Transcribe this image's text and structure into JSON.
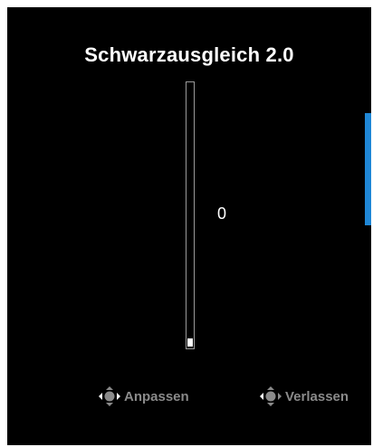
{
  "osd": {
    "title": "Schwarzausgleich 2.0",
    "value": "0",
    "slider": {
      "min": 0,
      "max": 20,
      "value": 0,
      "fill_fraction": 0.03
    },
    "colors": {
      "background": "#000000",
      "text": "#ffffff",
      "hint_text": "#8a8a8a",
      "accent": "#1f87d6"
    },
    "hints": [
      {
        "icon": "joystick-left-right-icon",
        "label": "Anpassen"
      },
      {
        "icon": "joystick-left-icon",
        "label": "Verlassen"
      }
    ]
  }
}
